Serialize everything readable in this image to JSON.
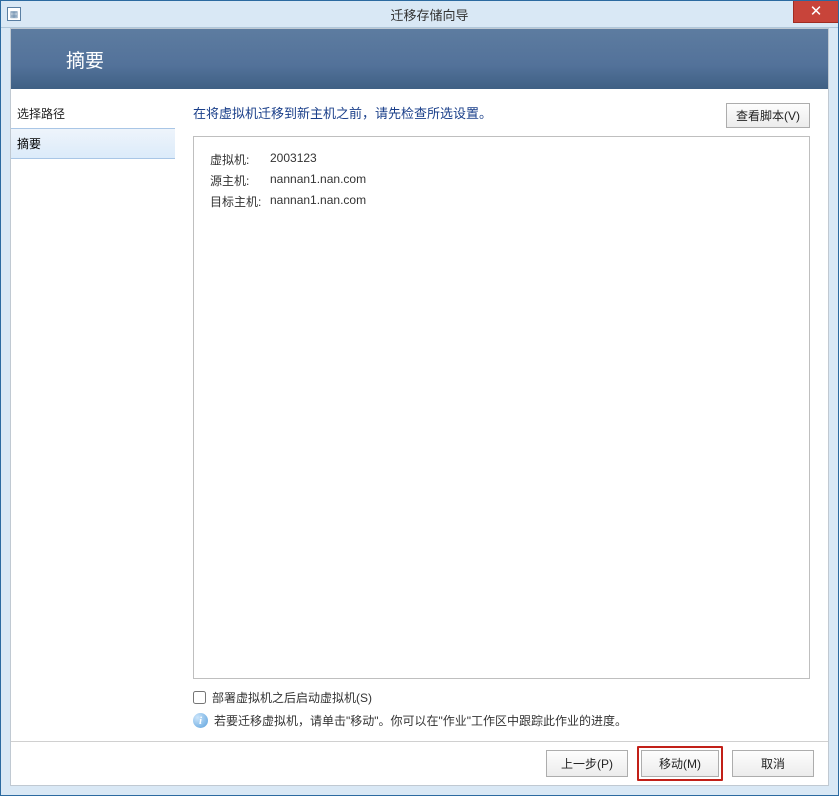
{
  "window": {
    "title": "迁移存储向导"
  },
  "banner": {
    "heading": "摘要"
  },
  "sidebar": {
    "items": [
      {
        "label": "选择路径"
      },
      {
        "label": "摘要"
      }
    ]
  },
  "content": {
    "headline": "在将虚拟机迁移到新主机之前，请先检查所选设置。",
    "view_script_btn": "查看脚本(V)",
    "details": [
      {
        "label": "虚拟机:",
        "value": "2003123"
      },
      {
        "label": "源主机:",
        "value": "nannan1.nan.com"
      },
      {
        "label": "目标主机:",
        "value": "nannan1.nan.com"
      }
    ],
    "checkbox_label": "部署虚拟机之后启动虚拟机(S)",
    "info_text": "若要迁移虚拟机，请单击\"移动\"。你可以在\"作业\"工作区中跟踪此作业的进度。"
  },
  "footer": {
    "prev": "上一步(P)",
    "move": "移动(M)",
    "cancel": "取消"
  }
}
